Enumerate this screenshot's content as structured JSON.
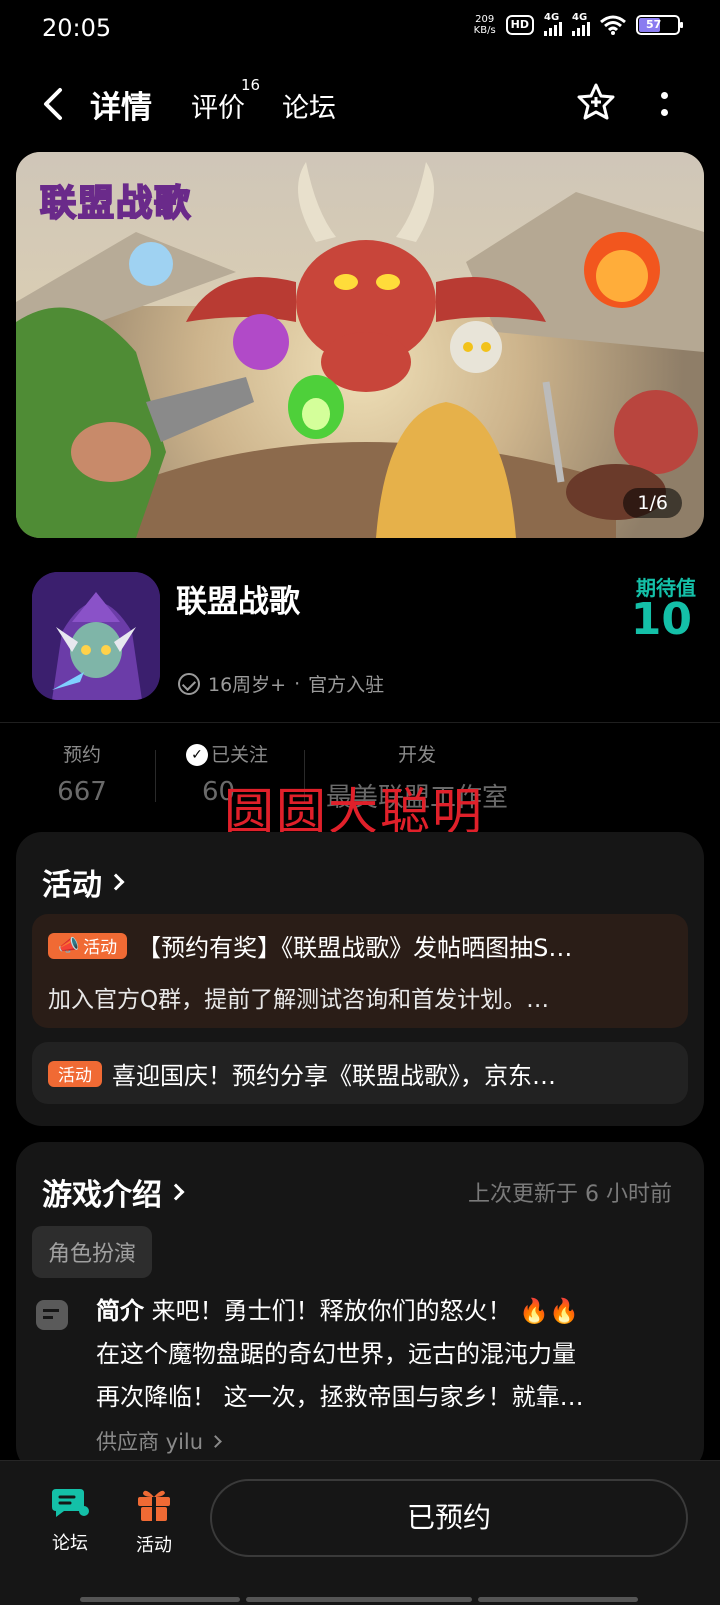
{
  "status_bar": {
    "time": "20:05",
    "net_speed_value": "209",
    "net_speed_unit": "KB/s",
    "hd_label": "HD",
    "signal1": "4G",
    "signal2": "4G",
    "battery": "57"
  },
  "nav": {
    "tabs": [
      {
        "label": "详情",
        "active": true
      },
      {
        "label": "评价",
        "count": "16"
      },
      {
        "label": "论坛"
      }
    ]
  },
  "banner": {
    "logo_text": "联盟战歌",
    "counter": "1/6"
  },
  "game": {
    "title": "联盟战歌",
    "age_rating": "16周岁+",
    "official_label": "官方入驻",
    "expectation_label": "期待值",
    "expectation_value": "10"
  },
  "stats": [
    {
      "label": "预约",
      "value": "667"
    },
    {
      "label": "已关注",
      "value": "60"
    },
    {
      "label": "开发",
      "value": "最美联盟工作室"
    }
  ],
  "watermark": "圆圆大聪明",
  "activities": {
    "title": "活动",
    "items": [
      {
        "badge": "活动",
        "text": "【预约有奖】《联盟战歌》发帖晒图抽S…",
        "subtext": "加入官方Q群，提前了解测试咨询和首发计划。…"
      },
      {
        "badge": "活动",
        "text": "喜迎国庆！预约分享《联盟战歌》，京东…"
      }
    ]
  },
  "intro": {
    "title": "游戏介绍",
    "updated": "上次更新于 6 小时前",
    "genre": "角色扮演",
    "summary_label": "简介",
    "lines": [
      "来吧！勇士们！释放你们的怒火！ 🔥🔥",
      "在这个魔物盘踞的奇幻世界，远古的混沌力量",
      "再次降临！ 这一次，拯救帝国与家乡！就靠…"
    ],
    "supplier": "供应商 yilu"
  },
  "bottom_bar": {
    "forum_label": "论坛",
    "activity_label": "活动",
    "reserve_button": "已预约"
  },
  "colors": {
    "accent": "#14c0a8",
    "activity_badge": "#f06a34",
    "watermark": "#e0202a"
  }
}
